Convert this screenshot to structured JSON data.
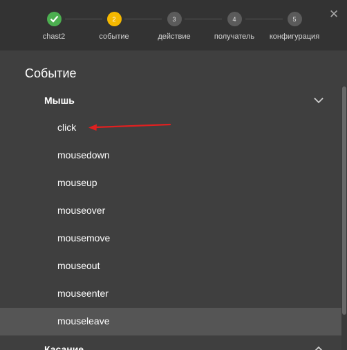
{
  "wizard": {
    "steps": [
      {
        "number": "✓",
        "label": "chast2",
        "state": "done"
      },
      {
        "number": "2",
        "label": "событие",
        "state": "active"
      },
      {
        "number": "3",
        "label": "действие",
        "state": "pending"
      },
      {
        "number": "4",
        "label": "получатель",
        "state": "pending"
      },
      {
        "number": "5",
        "label": "конфигурация",
        "state": "pending"
      }
    ],
    "close_icon": "✕"
  },
  "section": {
    "title": "Событие",
    "groups": [
      {
        "label": "Мышь",
        "expanded": true,
        "items": [
          "click",
          "mousedown",
          "mouseup",
          "mouseover",
          "mousemove",
          "mouseout",
          "mouseenter",
          "mouseleave"
        ],
        "hovered_item": "mouseleave"
      },
      {
        "label": "Касание",
        "expanded": false
      }
    ]
  },
  "annotation": {
    "type": "red-arrow",
    "points_to": "click",
    "color": "#e02020"
  },
  "colors": {
    "done": "#4caf50",
    "active": "#f5b800",
    "pending": "#5b5b5b"
  }
}
